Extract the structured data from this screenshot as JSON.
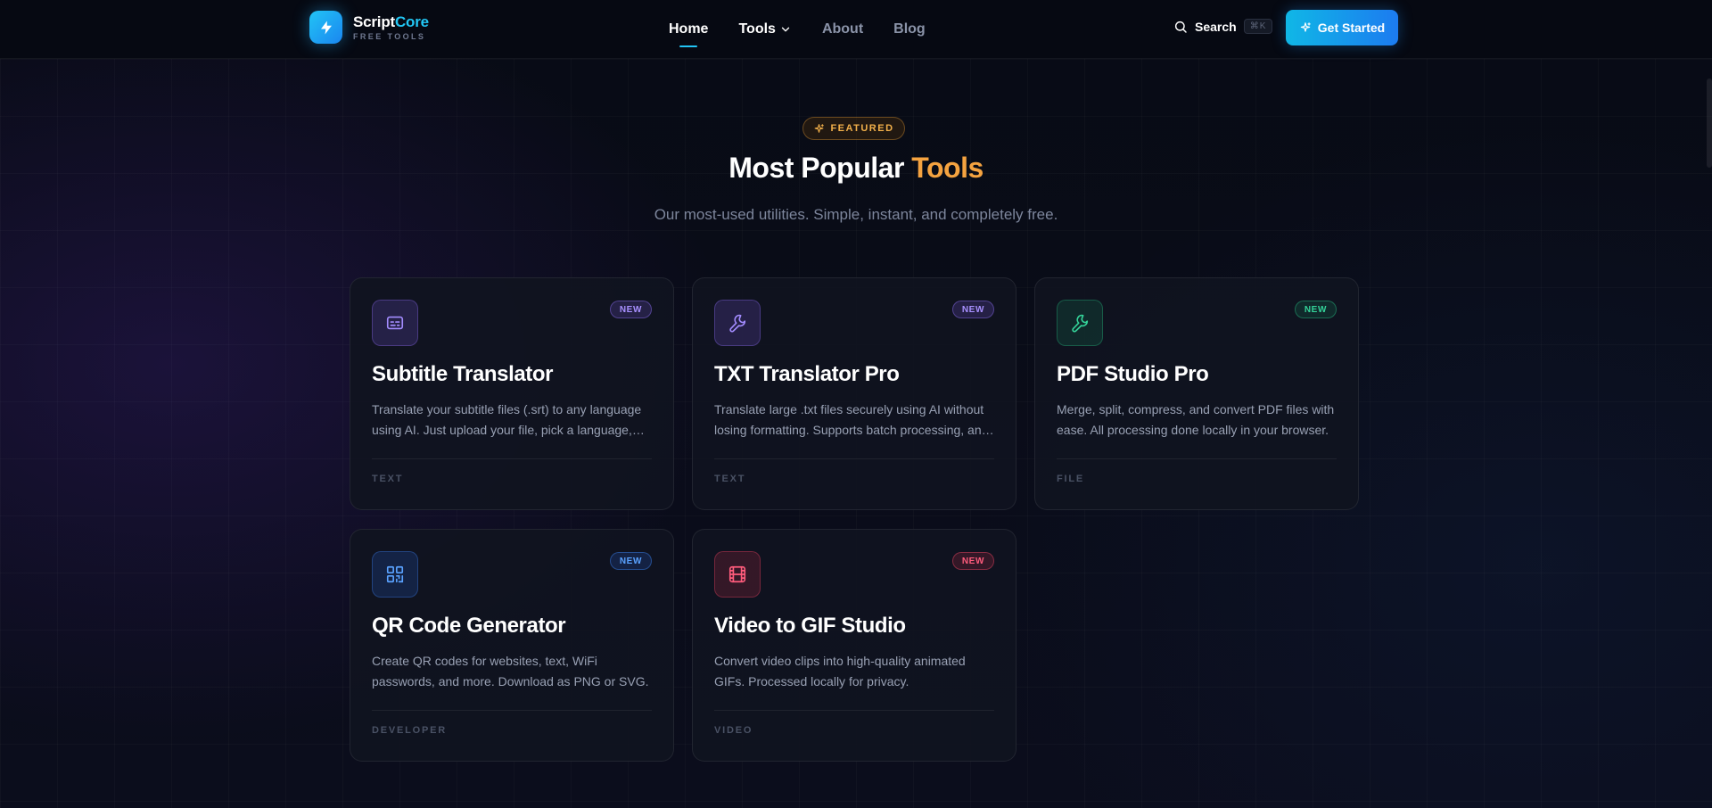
{
  "brand": {
    "name_main": "Script",
    "name_accent": "Core",
    "tagline": "FREE TOOLS"
  },
  "nav": {
    "items": [
      {
        "label": "Home"
      },
      {
        "label": "Tools"
      },
      {
        "label": "About"
      },
      {
        "label": "Blog"
      }
    ],
    "active": "Home"
  },
  "header": {
    "search_label": "Search",
    "search_shortcut": "⌘K",
    "cta_label": "Get Started"
  },
  "hero": {
    "badge": "FEATURED",
    "title_main": "Most Popular ",
    "title_highlight": "Tools",
    "subtitle": "Our most-used utilities. Simple, instant, and completely free."
  },
  "cards": [
    {
      "title": "Subtitle Translator",
      "badge": "NEW",
      "description": "Translate your subtitle files (.srt) to any language using AI. Just upload your file, pick a language, and download.",
      "category": "TEXT",
      "icon": "subtitles-icon",
      "accent": "#8b6cf0"
    },
    {
      "title": "TXT Translator Pro",
      "badge": "NEW",
      "description": "Translate large .txt files securely using AI without losing formatting. Supports batch processing, and more.",
      "category": "TEXT",
      "icon": "wrench-icon",
      "accent": "#8b6cf0"
    },
    {
      "title": "PDF Studio Pro",
      "badge": "NEW",
      "description": "Merge, split, compress, and convert PDF files with ease. All processing done locally in your browser.",
      "category": "FILE",
      "icon": "wrench-icon",
      "accent": "#34d399"
    },
    {
      "title": "QR Code Generator",
      "badge": "NEW",
      "description": "Create QR codes for websites, text, WiFi passwords, and more. Download as PNG or SVG.",
      "category": "DEVELOPER",
      "icon": "qr-code-icon",
      "accent": "#5aa2ff"
    },
    {
      "title": "Video to GIF Studio",
      "badge": "NEW",
      "description": "Convert video clips into high-quality animated GIFs. Processed locally for privacy.",
      "category": "VIDEO",
      "icon": "film-icon",
      "accent": "#ff5c7c"
    }
  ]
}
